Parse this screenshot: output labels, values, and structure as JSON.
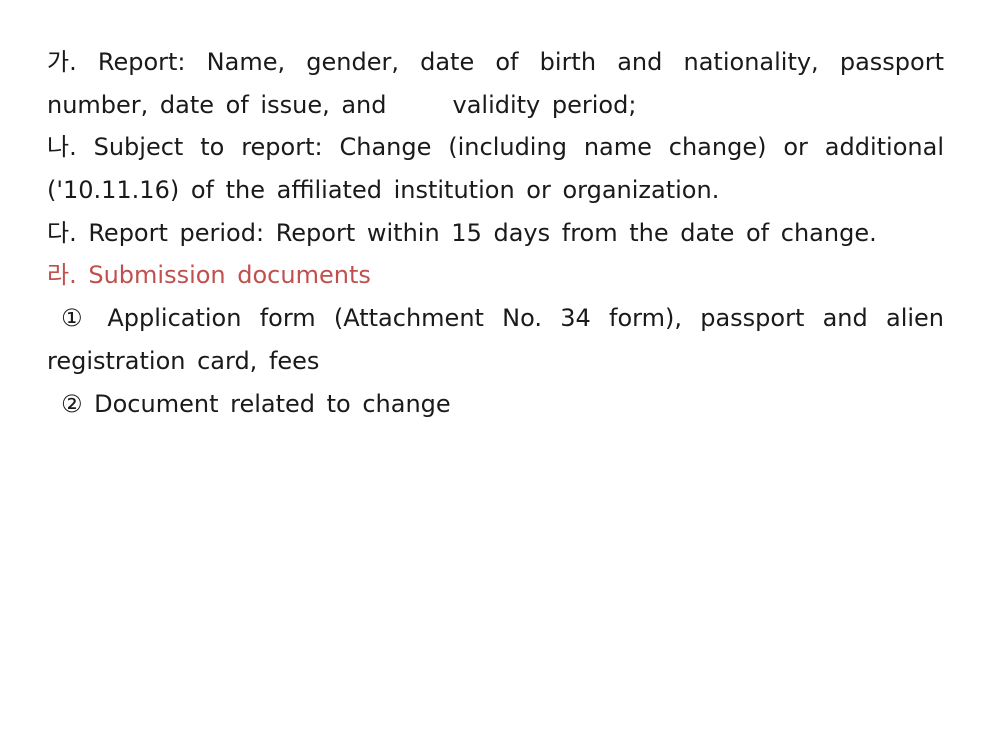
{
  "document": {
    "lines": [
      "가. Report: Name, gender, date of birth and nationality, passport",
      "number, date of issue, and",
      "validity period;",
      "나. Subject to report: Change (including name change) or additional",
      "('10.11.16) of the affiliated institution or organization.",
      "다. Report period: Report within 15 days from the date of change.",
      "라. Submission documents",
      "① Application form (Attachment No. 34 form), passport and alien",
      "registration card, fees",
      "② Document related to change"
    ],
    "accent_color": "#c0504d"
  }
}
